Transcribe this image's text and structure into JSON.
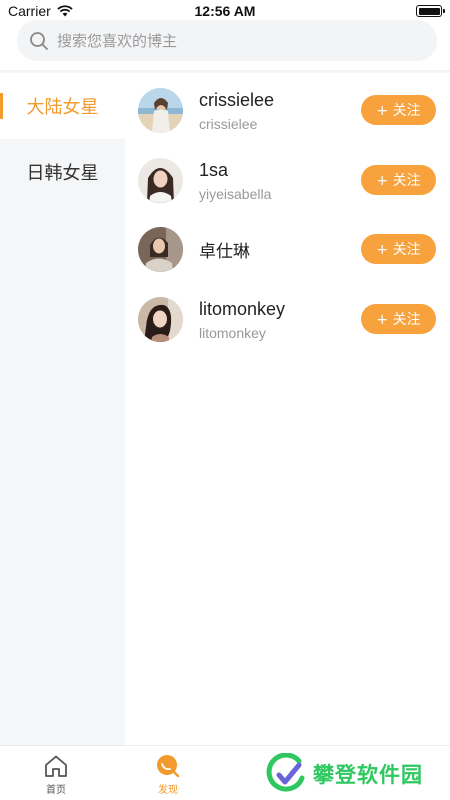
{
  "status_bar": {
    "carrier": "Carrier",
    "time": "12:56 AM"
  },
  "search": {
    "placeholder": "搜索您喜欢的博主"
  },
  "sidebar": {
    "items": [
      {
        "label": "大陆女星",
        "active": true
      },
      {
        "label": "日韩女星",
        "active": false
      }
    ]
  },
  "bloggers": [
    {
      "name": "crissielee",
      "handle": "crissielee",
      "follow_label": "+ 关注"
    },
    {
      "name": "1sa",
      "handle": "yiyeisabella",
      "follow_label": "+ 关注"
    },
    {
      "name": "卓仕琳",
      "handle": "",
      "follow_label": "+ 关注"
    },
    {
      "name": "litomonkey",
      "handle": "litomonkey",
      "follow_label": "+ 关注"
    }
  ],
  "tab_bar": {
    "tabs": [
      {
        "label": "首页",
        "icon": "home-icon",
        "active": false
      },
      {
        "label": "发现",
        "icon": "discover-icon",
        "active": true
      }
    ]
  },
  "watermark": {
    "text": "攀登软件园"
  },
  "colors": {
    "accent": "#f39a2e",
    "follow_button": "#f7a23c",
    "watermark": "#2ec760"
  }
}
